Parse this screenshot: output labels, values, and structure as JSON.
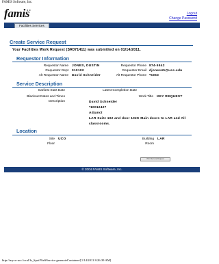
{
  "print_header": "FAMIS Software, Inc.",
  "logo": {
    "text": "famis"
  },
  "top_links": {
    "logout": "Logout",
    "change_password": "Change Password"
  },
  "nav": {
    "tab_label": "Facilities Services"
  },
  "page": {
    "title": "Create Service Request",
    "subtitle": "Your Facilities Work Request (SR071411) was submitted on 01/14/2011."
  },
  "requestor": {
    "heading": "Requestor Information",
    "name_label": "Requestor Name",
    "name": "JONES, DUSTIN",
    "dept_label": "Requestor Dept",
    "dept": "010102",
    "alt_name_label": "Alt Requestor Name",
    "alt_name": "David Schneider",
    "phone_label": "Requestor Phone",
    "phone": "874-5542",
    "email_label": "Requestor Email",
    "email": "djones45@ucc.edu",
    "alt_phone_label": "Alt Requestor Phone",
    "alt_phone": "*5353"
  },
  "service": {
    "heading": "Service Description",
    "start_label": "Earliest Start Date",
    "completion_label": "Latest Completion Date",
    "blackout_label": "Blackout Dates and Times",
    "worktitle_label": "Work Title",
    "work_title": "KEY REQUEST",
    "description_label": "Description",
    "description_lines": [
      "David Schneider",
      "*10012427",
      "Adjunct",
      "LAR Suite 102 and door 102K Main doors to LAR and All",
      "classrooms."
    ]
  },
  "location": {
    "heading": "Location",
    "site_label": "Site",
    "site": "UCO",
    "building_label": "Building",
    "building": "LAR",
    "floor_label": "Floor",
    "room_label": "Room"
  },
  "print_button": "Print Service Request",
  "footer": "© 2004 FAMIS Software, Inc.",
  "print_footer": "http://myco-ucc.local/fs_SpotFSelfService.generateContainer/[1/14/2011 8:26:39 AM]"
}
